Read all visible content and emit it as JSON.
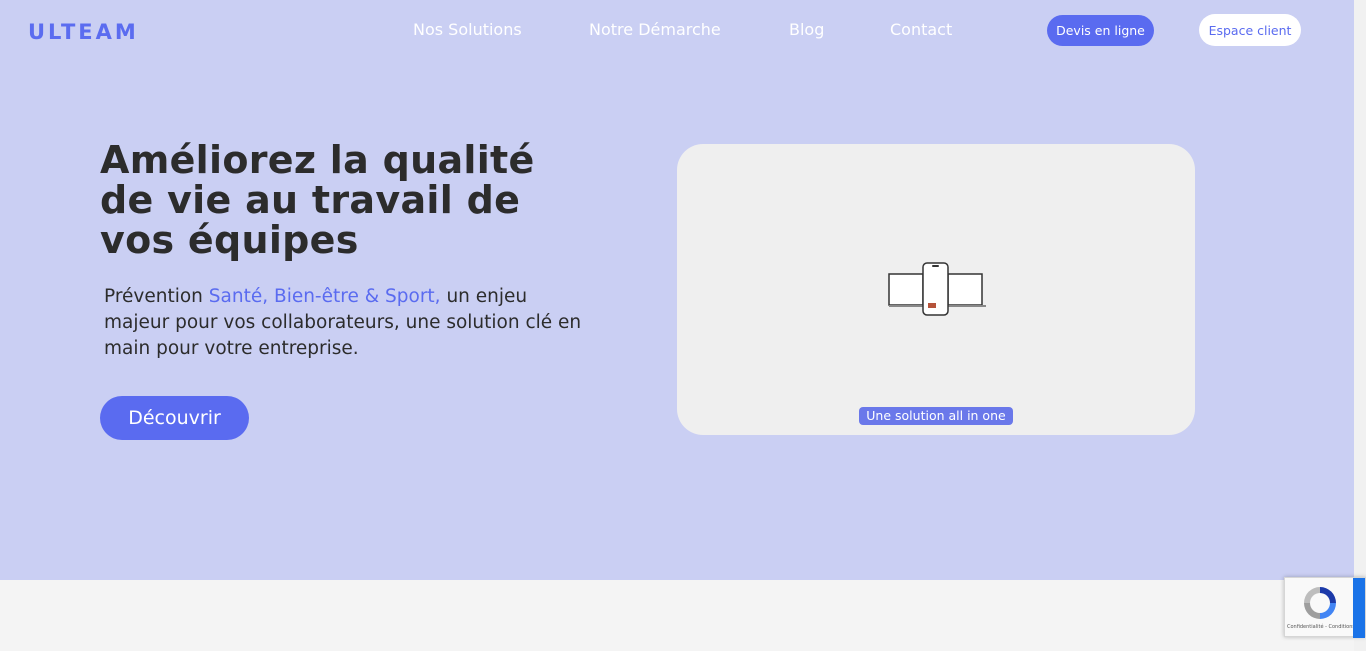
{
  "header": {
    "logo": "ULTEAM",
    "nav": [
      "Nos Solutions",
      "Notre Démarche",
      "Blog",
      "Contact"
    ],
    "cta_primary": "Devis en ligne",
    "cta_secondary": "Espace client"
  },
  "hero": {
    "headline": "Améliorez la qualité de vie au travail de vos équipes",
    "subtitle_prefix": "Prévention ",
    "subtitle_accent": "Santé, Bien-être & Sport,",
    "subtitle_suffix": " un enjeu majeur pour vos collaborateurs, une solution clé en main pour votre entreprise.",
    "button": "Découvrir"
  },
  "media": {
    "caption": "Une solution all in one",
    "icon": "devices-illustration-icon"
  },
  "recaptcha": {
    "label": "Confidentialité - Conditions",
    "icon": "recaptcha-icon"
  },
  "colors": {
    "hero_bg": "#cacff3",
    "accent": "#5a6bf0",
    "text": "#2c2c2c"
  }
}
